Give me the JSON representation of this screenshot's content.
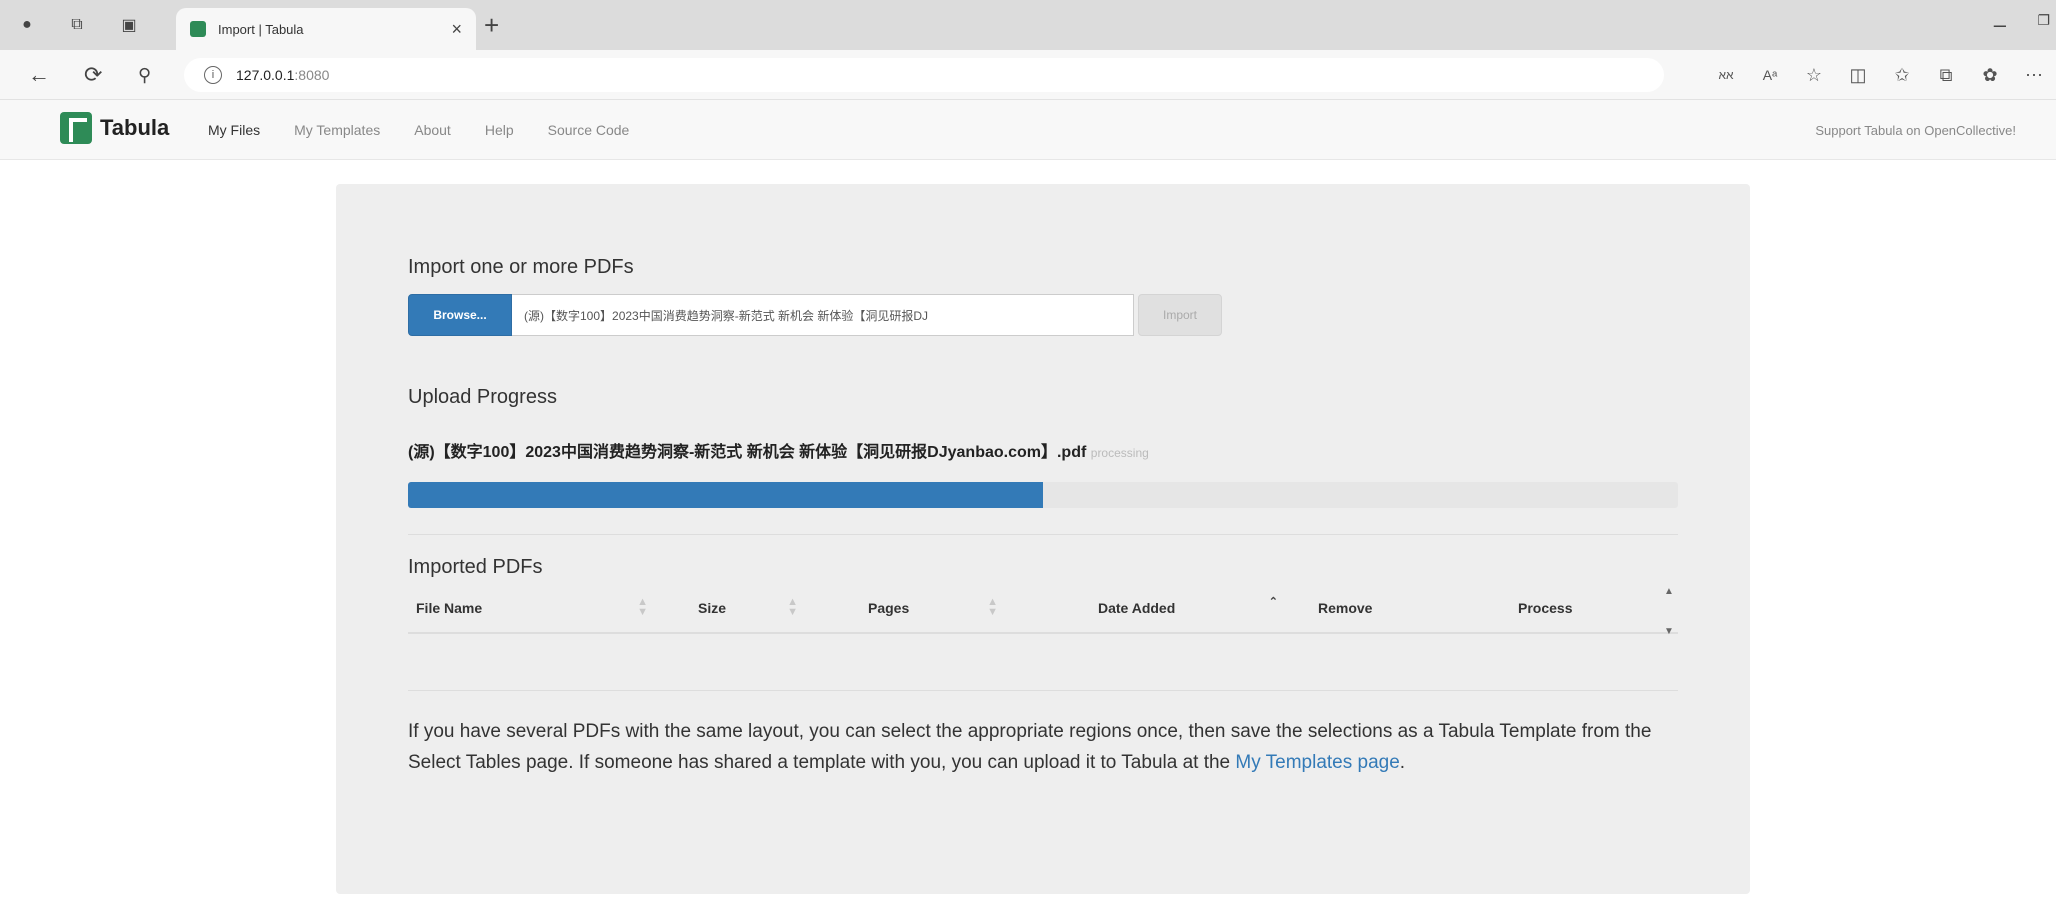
{
  "browser": {
    "tab_title": "Import | Tabula",
    "url_host": "127.0.0.1",
    "url_port": ":8080",
    "read_aloud_label": "Aᵃ"
  },
  "navbar": {
    "brand": "Tabula",
    "links": [
      "My Files",
      "My Templates",
      "About",
      "Help",
      "Source Code"
    ],
    "support": "Support Tabula on OpenCollective!"
  },
  "import": {
    "heading": "Import one or more PDFs",
    "browse_label": "Browse...",
    "selected_file": "(源)【数字100】2023中国消费趋势洞察-新范式 新机会 新体验【洞见研报DJ",
    "import_label": "Import"
  },
  "upload": {
    "heading": "Upload Progress",
    "file_name": "(源)【数字100】2023中国消费趋势洞察-新范式 新机会 新体验【洞见研报DJyanbao.com】.pdf",
    "status": "processing",
    "progress_percent": 50,
    "accent": "#337ab7"
  },
  "imported": {
    "heading": "Imported PDFs",
    "columns": [
      "File Name",
      "Size",
      "Pages",
      "Date Added",
      "Remove",
      "Process"
    ]
  },
  "help": {
    "text": "If you have several PDFs with the same layout, you can select the appropriate regions once, then save the selections as a Tabula Template from the Select Tables page. If someone has shared a template with you, you can upload it to Tabula at the ",
    "link": "My Templates page",
    "suffix": "."
  }
}
